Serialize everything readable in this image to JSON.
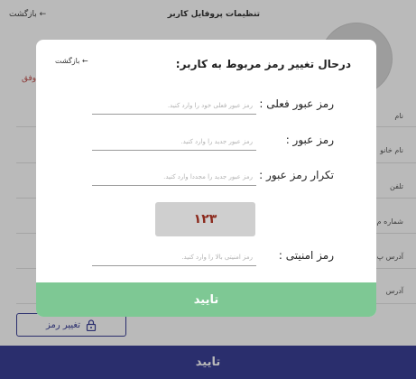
{
  "page": {
    "title": "تنظیمات پروفایل کاربر",
    "back": "بازگشت ←",
    "side_link": "وفق",
    "fields": [
      "نام",
      "نام خانو",
      "تلفن",
      "شماره م",
      "آدرس پ",
      "آدرس"
    ],
    "change_password_label": "تغییر رمز",
    "confirm_label": "تایید"
  },
  "modal": {
    "title": "درحال تغییر رمز مربوط به کاربر:",
    "back": "بازگشت ←",
    "current_password": {
      "label": "رمز عبور فعلی :",
      "placeholder": "رمز عبور فعلی خود را وارد کنید."
    },
    "new_password": {
      "label": "رمز عبور :",
      "placeholder": "رمز عبور جدید را وارد کنید."
    },
    "repeat_password": {
      "label": "تکرار رمز عبور :",
      "placeholder": "رمز عبور جدید را مجددا وارد کنید."
    },
    "captcha_text": "۱۲۳",
    "security_code": {
      "label": "رمز امنیتی :",
      "placeholder": "رمز امنیتی بالا را وارد کنید."
    },
    "confirm_label": "تایید"
  },
  "colors": {
    "primary": "#3a3f96",
    "confirm_green": "#7ec894",
    "captcha_text": "#8c2a1d"
  }
}
